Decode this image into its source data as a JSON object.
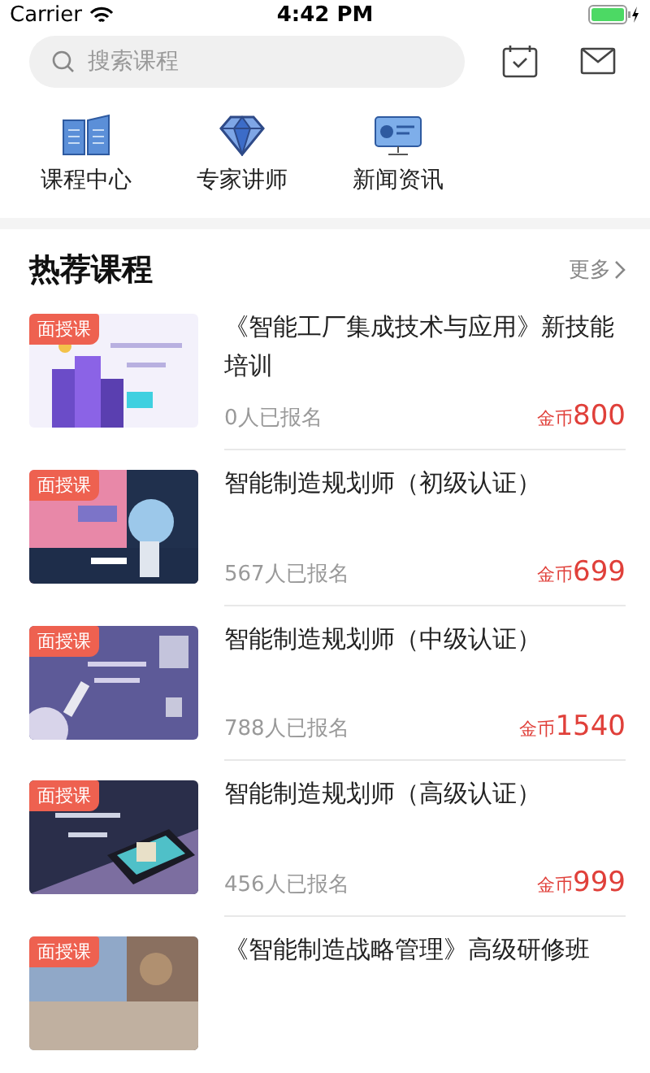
{
  "status_bar": {
    "carrier": "Carrier",
    "time": "4:42 PM"
  },
  "search": {
    "placeholder": "搜索课程"
  },
  "categories": [
    {
      "label": "课程中心",
      "kind": "book"
    },
    {
      "label": "专家讲师",
      "kind": "diamond"
    },
    {
      "label": "新闻资讯",
      "kind": "monitor"
    }
  ],
  "section": {
    "title": "热荐课程",
    "more": "更多"
  },
  "courses": [
    {
      "badge": "面授课",
      "title": "《智能工厂集成技术与应用》新技能培训",
      "enrolled": "0人已报名",
      "currency": "金币",
      "price": "800"
    },
    {
      "badge": "面授课",
      "title": "智能制造规划师（初级认证）",
      "enrolled": "567人已报名",
      "currency": "金币",
      "price": "699"
    },
    {
      "badge": "面授课",
      "title": "智能制造规划师（中级认证）",
      "enrolled": "788人已报名",
      "currency": "金币",
      "price": "1540"
    },
    {
      "badge": "面授课",
      "title": "智能制造规划师（高级认证）",
      "enrolled": "456人已报名",
      "currency": "金币",
      "price": "999"
    },
    {
      "badge": "面授课",
      "title": "《智能制造战略管理》高级研修班"
    }
  ]
}
